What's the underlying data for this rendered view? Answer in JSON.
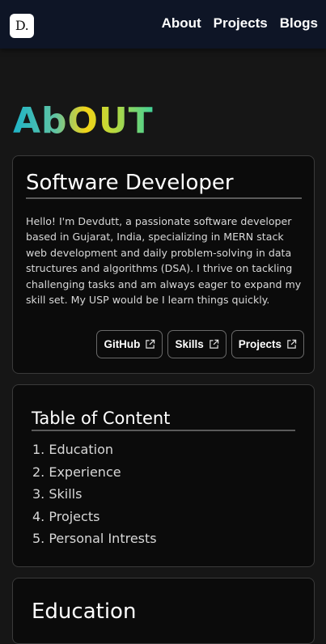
{
  "nav": {
    "logo_text": "D.",
    "links": [
      "About",
      "Projects",
      "Blogs"
    ]
  },
  "page": {
    "heading": "AbOUT"
  },
  "developer_card": {
    "title": "Software Developer",
    "bio": "Hello! I'm Devdutt, a passionate software developer based in Gujarat, India, specializing in MERN stack web development and daily problem-solving in data structures and algorithms (DSA). I thrive on tackling challenging tasks and am always eager to expand my skill set. My USP would be I learn things quickly.",
    "buttons": [
      "GitHub",
      "Skills",
      "Projects"
    ]
  },
  "toc": {
    "title": "Table of Content",
    "items": [
      "1. Education",
      "2. Experience",
      "3. Skills",
      "4. Projects",
      "5. Personal Intrests"
    ]
  },
  "education": {
    "title": "Education"
  },
  "colors": {
    "nav_bg": "#0e1526",
    "page_bg": "#161616",
    "card_bg": "#0b0b0b",
    "heading_gradient": [
      "#1fb4c8",
      "#f2d417",
      "#3fd19a"
    ]
  },
  "icons": {
    "button_icon": "external-link-icon"
  }
}
